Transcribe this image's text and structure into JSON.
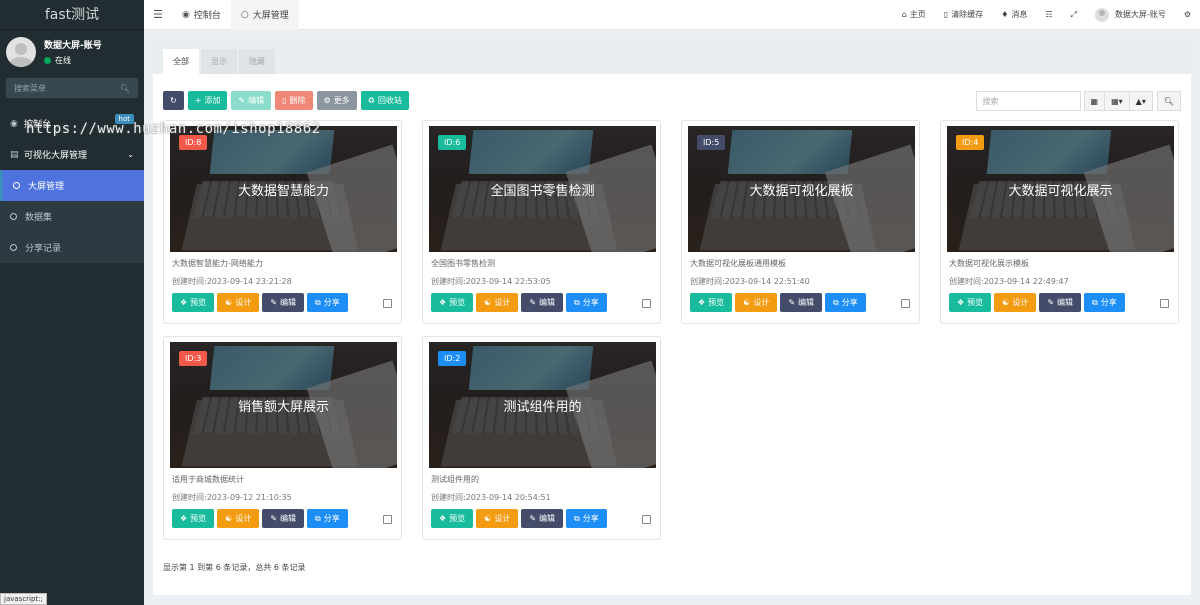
{
  "app": {
    "logo": "fast测试"
  },
  "user": {
    "name": "数据大屏-账号",
    "status": "在线"
  },
  "sidebar": {
    "search_placeholder": "搜索菜单",
    "items": [
      {
        "label": "控制台",
        "badge": "hot"
      },
      {
        "label": "可视化大屏管理"
      },
      {
        "label": "大屏管理"
      },
      {
        "label": "数据集"
      },
      {
        "label": "分享记录"
      }
    ]
  },
  "statusbar": "javascript:;",
  "topnav": {
    "tabs": [
      {
        "label": "控制台"
      },
      {
        "label": "大屏管理"
      }
    ],
    "links": {
      "home": "主页",
      "clear_cache": "清除缓存",
      "messages": "消息",
      "user": "数据大屏-账号"
    }
  },
  "content": {
    "tabs": [
      "全部",
      "显示",
      "隐藏"
    ],
    "toolbar": {
      "add": "添加",
      "edit": "编辑",
      "delete": "删除",
      "more": "更多",
      "recycle": "回收站"
    },
    "search_placeholder": "搜索",
    "pagination_info": "显示第 1 到第 6 条记录，总共 6 条记录"
  },
  "card_actions": {
    "view": "预览",
    "design": "设计",
    "edit": "编辑",
    "share": "分享"
  },
  "cards": [
    {
      "id": "ID:8",
      "title": "大数据智慧能力",
      "desc": "大数据智慧能力-网络能力",
      "time": "创建时间:2023-09-14 23:21:28",
      "badge_color": "#f2594b"
    },
    {
      "id": "ID:6",
      "title": "全国图书零售检测",
      "desc": "全国图书零售检测",
      "time": "创建时间:2023-09-14 22:53:05",
      "badge_color": "#18bc9c"
    },
    {
      "id": "ID:5",
      "title": "大数据可视化展板",
      "desc": "大数据可视化展板通用模板",
      "time": "创建时间:2023-09-14 22:51:40",
      "badge_color": "#444c69"
    },
    {
      "id": "ID:4",
      "title": "大数据可视化展示",
      "desc": "大数据可视化展示模板",
      "time": "创建时间:2023-09-14 22:49:47",
      "badge_color": "#f39c12"
    },
    {
      "id": "ID:3",
      "title": "销售额大屏展示",
      "desc": "适用于商城数据统计",
      "time": "创建时间:2023-09-12 21:10:35",
      "badge_color": "#f2594b"
    },
    {
      "id": "ID:2",
      "title": "测试组件用的",
      "desc": "测试组件用的",
      "time": "创建时间:2023-09-14 20:54:51",
      "badge_color": "#1c8ef6"
    }
  ],
  "watermark": "https://www.huzhan.com/ishop18862"
}
